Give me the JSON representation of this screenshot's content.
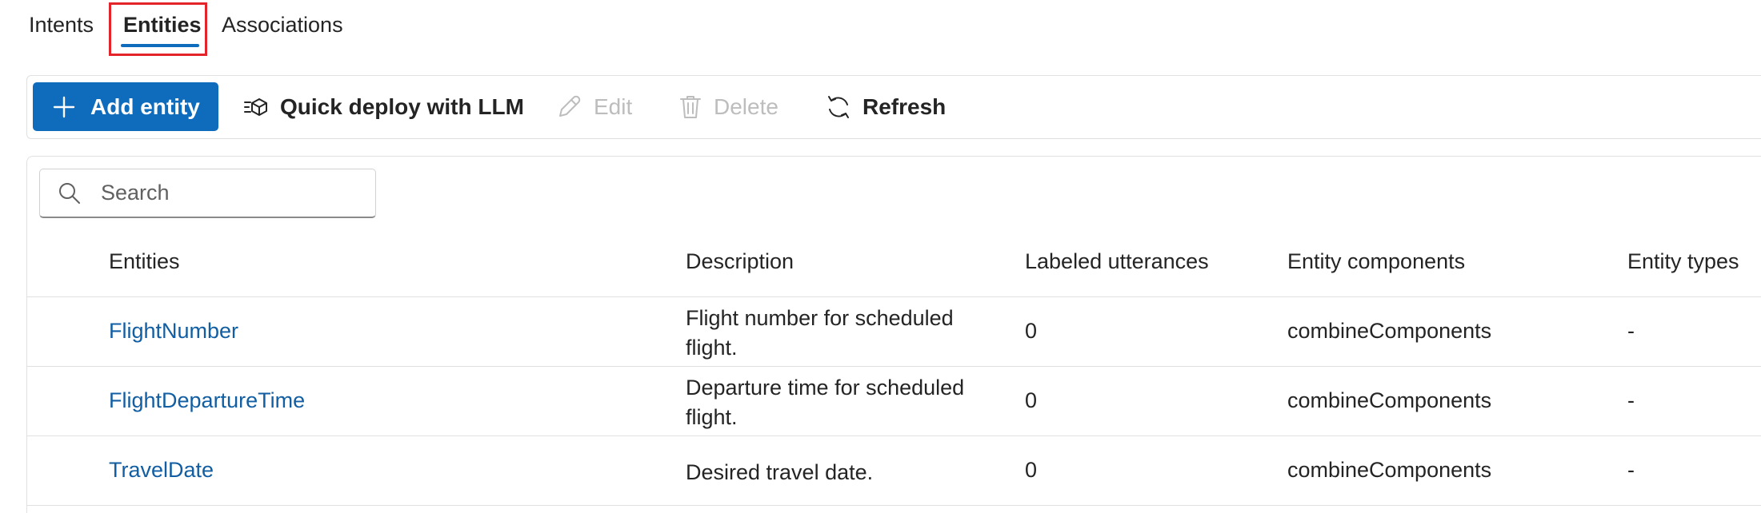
{
  "tabs": [
    {
      "label": "Intents"
    },
    {
      "label": "Entities"
    },
    {
      "label": "Associations"
    }
  ],
  "active_tab": "Entities",
  "toolbar": {
    "add_label": "Add entity",
    "quick_deploy_label": "Quick deploy with LLM",
    "edit_label": "Edit",
    "delete_label": "Delete",
    "refresh_label": "Refresh"
  },
  "search": {
    "placeholder": "Search",
    "value": ""
  },
  "table": {
    "headers": [
      "Entities",
      "Description",
      "Labeled utterances",
      "Entity components",
      "Entity types"
    ],
    "rows": [
      {
        "name": "FlightNumber",
        "description": "Flight number for scheduled flight.",
        "labeled_utterances": "0",
        "components": "combineComponents",
        "types": "-"
      },
      {
        "name": "FlightDepartureTime",
        "description": "Departure time for scheduled flight.",
        "labeled_utterances": "0",
        "components": "combineComponents",
        "types": "-"
      },
      {
        "name": "TravelDate",
        "description": "Desired travel date.",
        "labeled_utterances": "0",
        "components": "combineComponents",
        "types": "-"
      }
    ]
  },
  "colors": {
    "accent": "#0f6cbd",
    "link": "#115ea3",
    "highlight": "#e3242b",
    "disabled": "#bdbdbd"
  },
  "icons": {
    "add": "plus-icon",
    "quick_deploy": "deploy-icon",
    "edit": "pencil-icon",
    "delete": "trash-icon",
    "refresh": "refresh-icon",
    "search": "search-icon"
  }
}
